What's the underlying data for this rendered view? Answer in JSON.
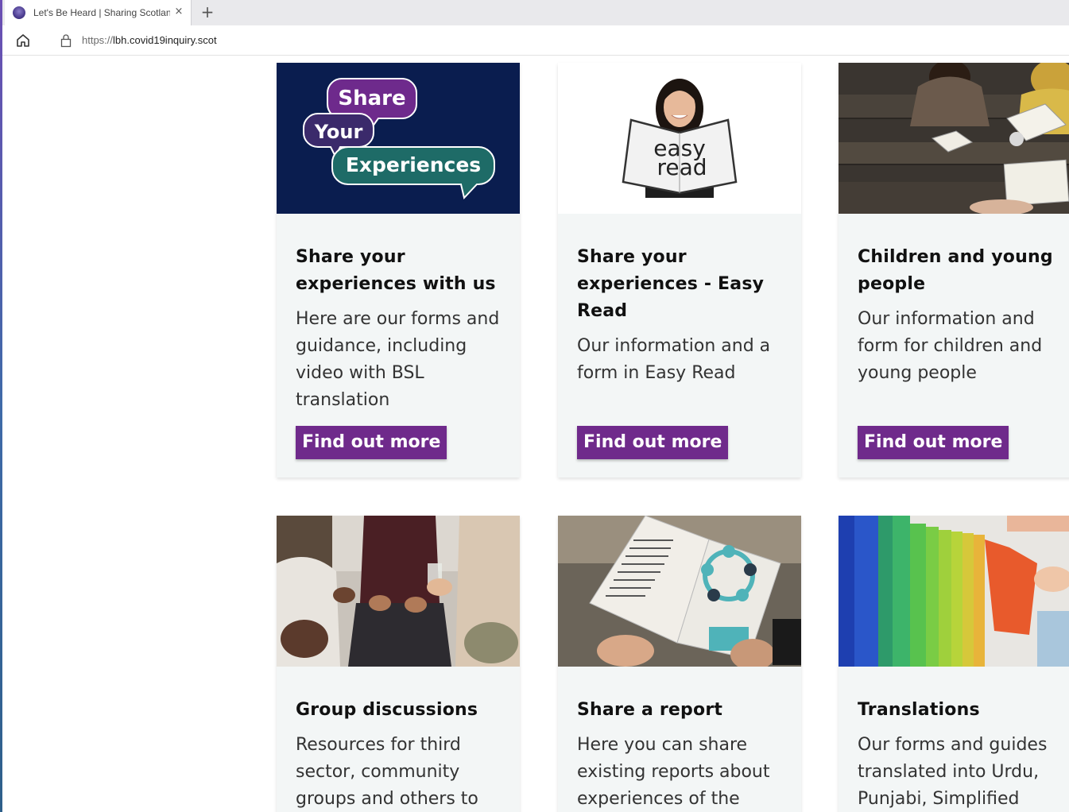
{
  "browser": {
    "tab_title": "Let's Be Heard | Sharing Scotland",
    "tab_close": "×",
    "new_tab": "+",
    "url_scheme": "https://",
    "url_host": "lbh.covid19inquiry.scot"
  },
  "colors": {
    "button": "#6f2a8b",
    "card_bg": "#f3f6f6",
    "logo_navy": "#0a1d4f",
    "logo_purple": "#6e2a8c",
    "logo_teal": "#1e6b67"
  },
  "logo_words": [
    "Share",
    "Your",
    "Experiences"
  ],
  "easy_read_words": [
    "easy",
    "read"
  ],
  "cards": [
    {
      "title": "Share your experiences with us",
      "description": "Here are our forms and guidance, including video with BSL translation",
      "button": "Find out more",
      "image": "share-your-experiences-logo"
    },
    {
      "title": "Share your experiences - Easy Read",
      "description": "Our information and a form in Easy Read",
      "button": "Find out more",
      "image": "easy-read-photo"
    },
    {
      "title": "Children and young people",
      "description": "Our information and form for children and young people",
      "button": "Find out more",
      "image": "young-people-photo"
    },
    {
      "title": "Group discussions",
      "description": "Resources for third sector, community groups and others to",
      "image": "group-discussion-photo"
    },
    {
      "title": "Share a report",
      "description": "Here you can share existing reports about experiences of the",
      "image": "report-photo"
    },
    {
      "title": "Translations",
      "description": "Our forms and guides translated into Urdu, Punjabi, Simplified",
      "image": "books-photo"
    }
  ]
}
